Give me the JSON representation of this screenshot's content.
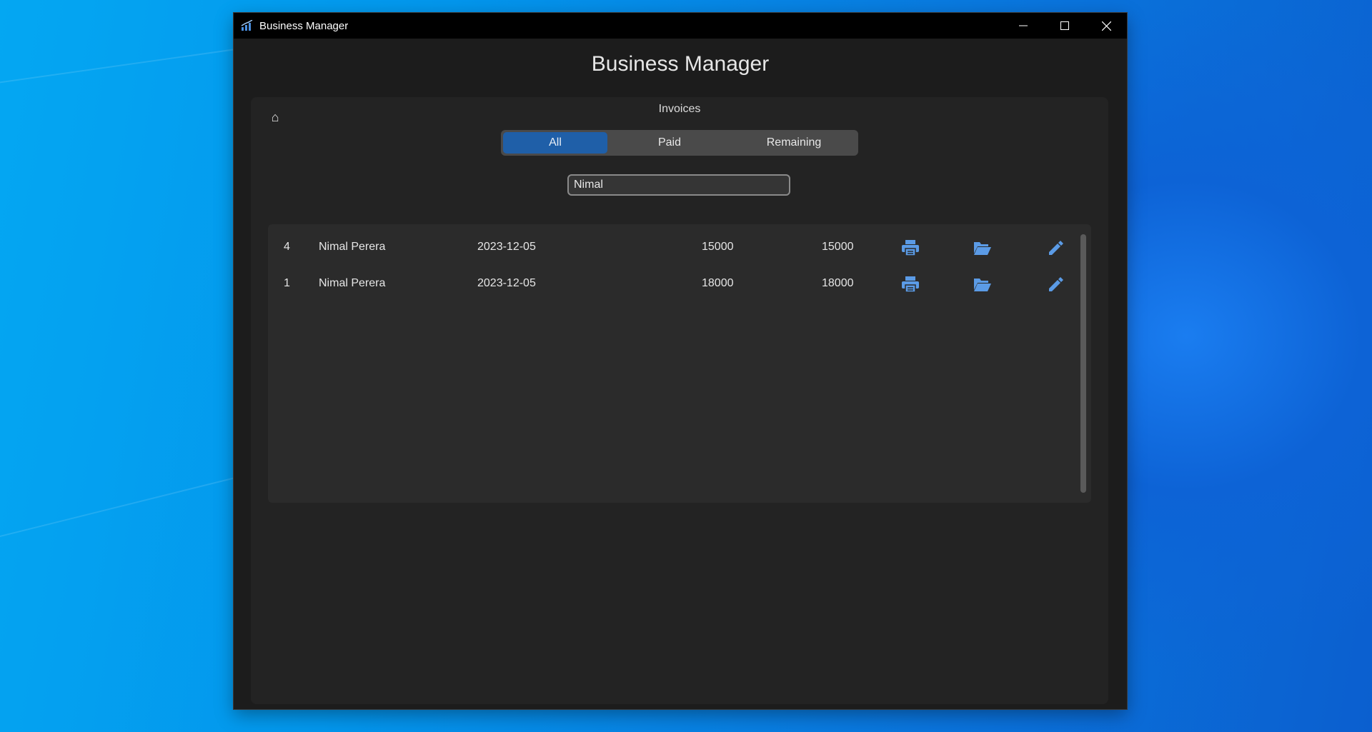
{
  "window": {
    "title": "Business Manager"
  },
  "app": {
    "title": "Business Manager"
  },
  "page": {
    "section_title": "Invoices",
    "home_icon": "⌂"
  },
  "filter_tabs": [
    {
      "label": "All",
      "active": true
    },
    {
      "label": "Paid",
      "active": false
    },
    {
      "label": "Remaining",
      "active": false
    }
  ],
  "search": {
    "value": "Nimal",
    "placeholder": ""
  },
  "invoices": [
    {
      "id": "4",
      "customer": "Nimal Perera",
      "date": "2023-12-05",
      "total": "15000",
      "remaining": "15000"
    },
    {
      "id": "1",
      "customer": "Nimal Perera",
      "date": "2023-12-05",
      "total": "18000",
      "remaining": "18000"
    }
  ],
  "row_actions": [
    "print-icon",
    "folder-open-icon",
    "pencil-icon"
  ],
  "colors": {
    "accent": "#5b9be6",
    "active_tab": "#1f5fa8",
    "panel": "#232323",
    "list_bg": "#2b2b2b"
  }
}
